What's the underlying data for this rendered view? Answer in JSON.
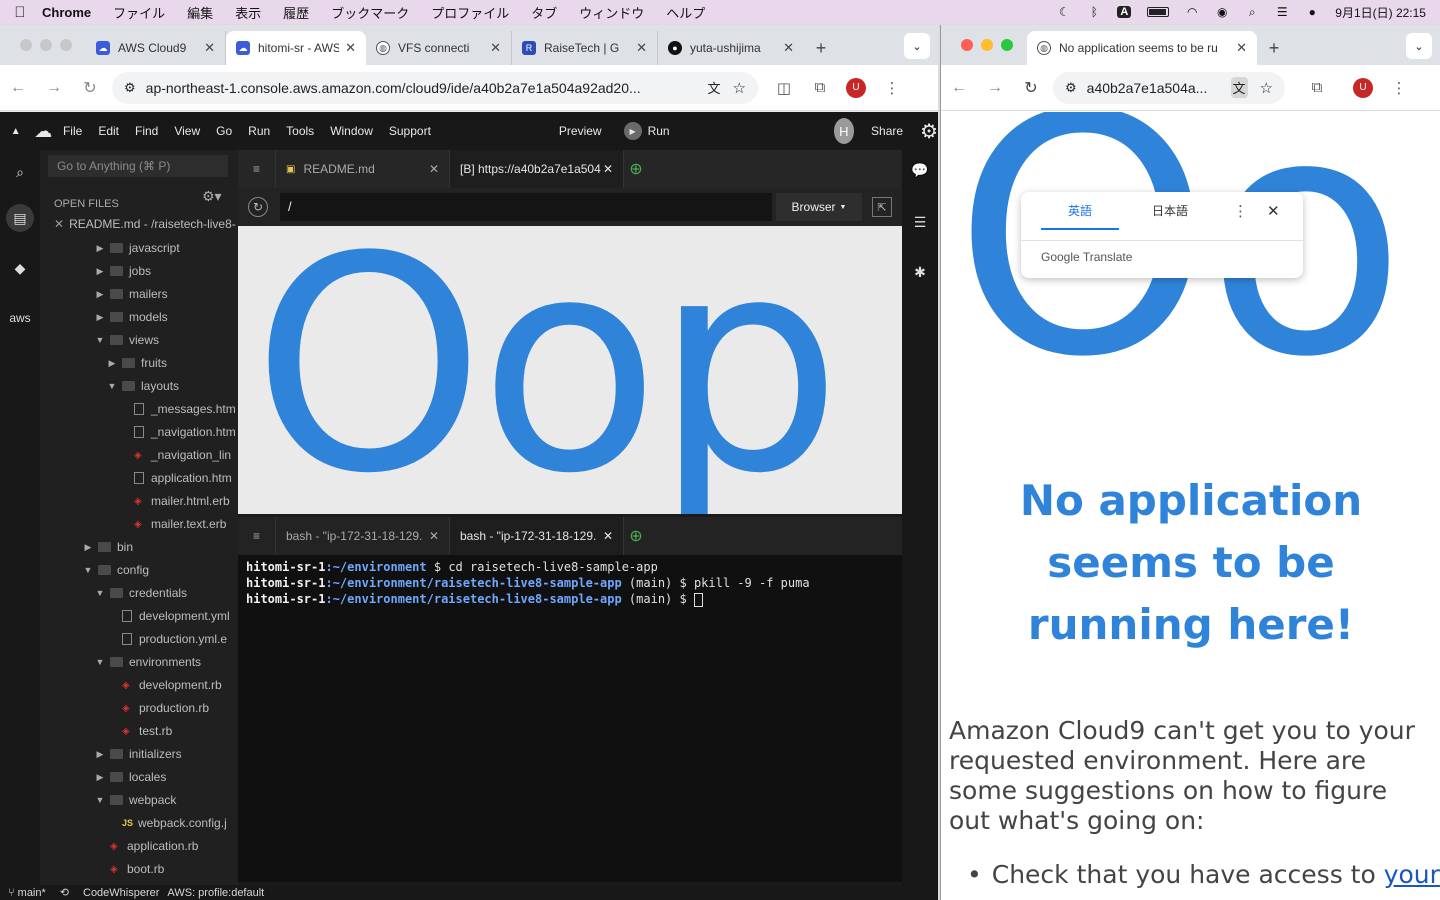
{
  "menubar": {
    "app": "Chrome",
    "items": [
      "ファイル",
      "編集",
      "表示",
      "履歴",
      "ブックマーク",
      "プロファイル",
      "タブ",
      "ウィンドウ",
      "ヘルプ"
    ],
    "input_mode": "A",
    "clock": "9月1日(日) 22:15"
  },
  "left_window": {
    "tabs": [
      {
        "title": "AWS Cloud9",
        "favicon": "cloud9",
        "active": false
      },
      {
        "title": "hitomi-sr - AWS",
        "favicon": "cloud9",
        "active": true
      },
      {
        "title": "VFS connecti",
        "favicon": "globe",
        "active": false
      },
      {
        "title": "RaiseTech | G",
        "favicon": "raisetech",
        "active": false
      },
      {
        "title": "yuta-ushijima",
        "favicon": "github",
        "active": false
      }
    ],
    "url": "ap-northeast-1.console.aws.amazon.com/cloud9/ide/a40b2a7e1a504a92ad20...",
    "profile_initial": "U"
  },
  "ide": {
    "menu": [
      "File",
      "Edit",
      "Find",
      "View",
      "Go",
      "Run",
      "Tools",
      "Window",
      "Support"
    ],
    "preview_label": "Preview",
    "run_label": "Run",
    "user_initial": "H",
    "share_label": "Share",
    "goto_placeholder": "Go to Anything (⌘ P)",
    "open_files_label": "OPEN FILES",
    "open_file": "README.md - /raisetech-live8-",
    "aws_label": "aws",
    "tree": [
      {
        "name": "javascript",
        "type": "folder",
        "depth": 1,
        "open": false
      },
      {
        "name": "jobs",
        "type": "folder",
        "depth": 1,
        "open": false
      },
      {
        "name": "mailers",
        "type": "folder",
        "depth": 1,
        "open": false
      },
      {
        "name": "models",
        "type": "folder",
        "depth": 1,
        "open": false
      },
      {
        "name": "views",
        "type": "folder",
        "depth": 1,
        "open": true
      },
      {
        "name": "fruits",
        "type": "folder",
        "depth": 2,
        "open": false
      },
      {
        "name": "layouts",
        "type": "folder",
        "depth": 2,
        "open": true
      },
      {
        "name": "_messages.htm",
        "type": "file",
        "depth": 3
      },
      {
        "name": "_navigation.htm",
        "type": "file",
        "depth": 3
      },
      {
        "name": "_navigation_lin",
        "type": "ruby",
        "depth": 3
      },
      {
        "name": "application.htm",
        "type": "file",
        "depth": 3
      },
      {
        "name": "mailer.html.erb",
        "type": "ruby",
        "depth": 3
      },
      {
        "name": "mailer.text.erb",
        "type": "ruby",
        "depth": 3
      },
      {
        "name": "bin",
        "type": "folder",
        "depth": 0,
        "open": false
      },
      {
        "name": "config",
        "type": "folder",
        "depth": 0,
        "open": true
      },
      {
        "name": "credentials",
        "type": "folder",
        "depth": 1,
        "open": true
      },
      {
        "name": "development.yml",
        "type": "file",
        "depth": 2
      },
      {
        "name": "production.yml.e",
        "type": "file",
        "depth": 2
      },
      {
        "name": "environments",
        "type": "folder",
        "depth": 1,
        "open": true
      },
      {
        "name": "development.rb",
        "type": "ruby",
        "depth": 2
      },
      {
        "name": "production.rb",
        "type": "ruby",
        "depth": 2
      },
      {
        "name": "test.rb",
        "type": "ruby",
        "depth": 2
      },
      {
        "name": "initializers",
        "type": "folder",
        "depth": 1,
        "open": false
      },
      {
        "name": "locales",
        "type": "folder",
        "depth": 1,
        "open": false
      },
      {
        "name": "webpack",
        "type": "folder",
        "depth": 1,
        "open": true
      },
      {
        "name": "webpack.config.j",
        "type": "js",
        "depth": 2
      },
      {
        "name": "application.rb",
        "type": "ruby",
        "depth": 1
      },
      {
        "name": "boot.rb",
        "type": "ruby",
        "depth": 1
      }
    ],
    "editor_tabs": [
      "README.md",
      "[B] https://a40b2a7e1a504"
    ],
    "preview_path": "/",
    "browser_label": "Browser",
    "preview_text": "Oop",
    "terminal_tabs": [
      "bash - \"ip-172-31-18-129.",
      "bash - \"ip-172-31-18-129."
    ],
    "terminal_lines": [
      {
        "user": "hitomi-sr-1",
        "path": ":~/environment",
        "rest": " $ cd raisetech-live8-sample-app"
      },
      {
        "user": "hitomi-sr-1",
        "path": ":~/environment/raisetech-live8-sample-app",
        "rest": " (main) $ pkill -9 -f puma"
      },
      {
        "user": "hitomi-sr-1",
        "path": ":~/environment/raisetech-live8-sample-app",
        "rest": " (main) $ "
      }
    ],
    "status": {
      "branch": "main*",
      "codewhisperer": "CodeWhisperer",
      "aws_profile": "AWS: profile:default"
    }
  },
  "right_window": {
    "tab_title": "No application seems to be ru",
    "url": "a40b2a7e1a504a...",
    "profile_initial": "U",
    "translate": {
      "lang_source": "英語",
      "lang_target": "日本語",
      "brand": "Google Translate"
    },
    "page": {
      "big_text": "Oo",
      "heading": "No application seems to be running here!",
      "body": "Amazon Cloud9 can't get you to your requested environment. Here are some suggestions on how to figure out what's going on:",
      "bullet_prefix": "Check that you have access to ",
      "bullet_link": "your"
    }
  },
  "colors": {
    "accent": "#2f84da",
    "ide_bg": "#1b1b1b",
    "term_path": "#6ea8ff"
  }
}
